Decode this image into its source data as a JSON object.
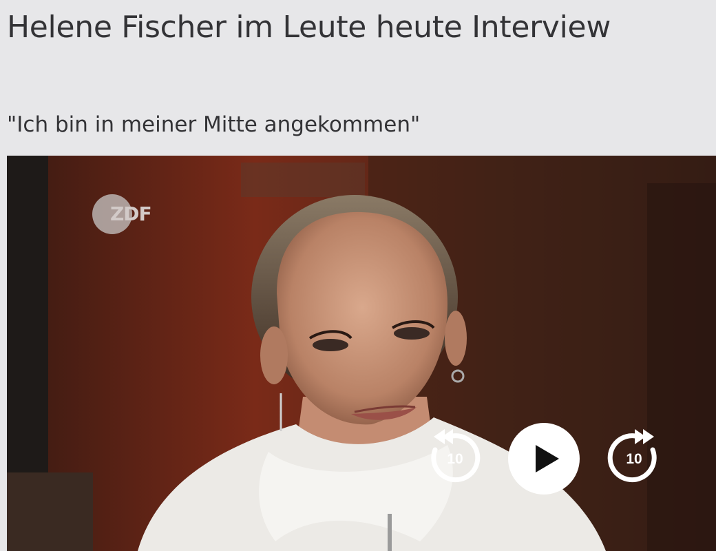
{
  "article": {
    "title": "Helene Fischer im Leute heute Interview",
    "subtitle": "\"Ich bin in meiner Mitte angekommen\""
  },
  "video": {
    "channel_logo": "ZDF",
    "controls": {
      "rewind_label": "10",
      "rewind_icon": "rewind-10-icon",
      "play_icon": "play-icon",
      "forward_label": "10",
      "forward_icon": "forward-10-icon"
    },
    "state": "paused"
  },
  "colors": {
    "page_background": "#e7e7e9",
    "text": "#333336",
    "control_white": "#ffffff"
  }
}
